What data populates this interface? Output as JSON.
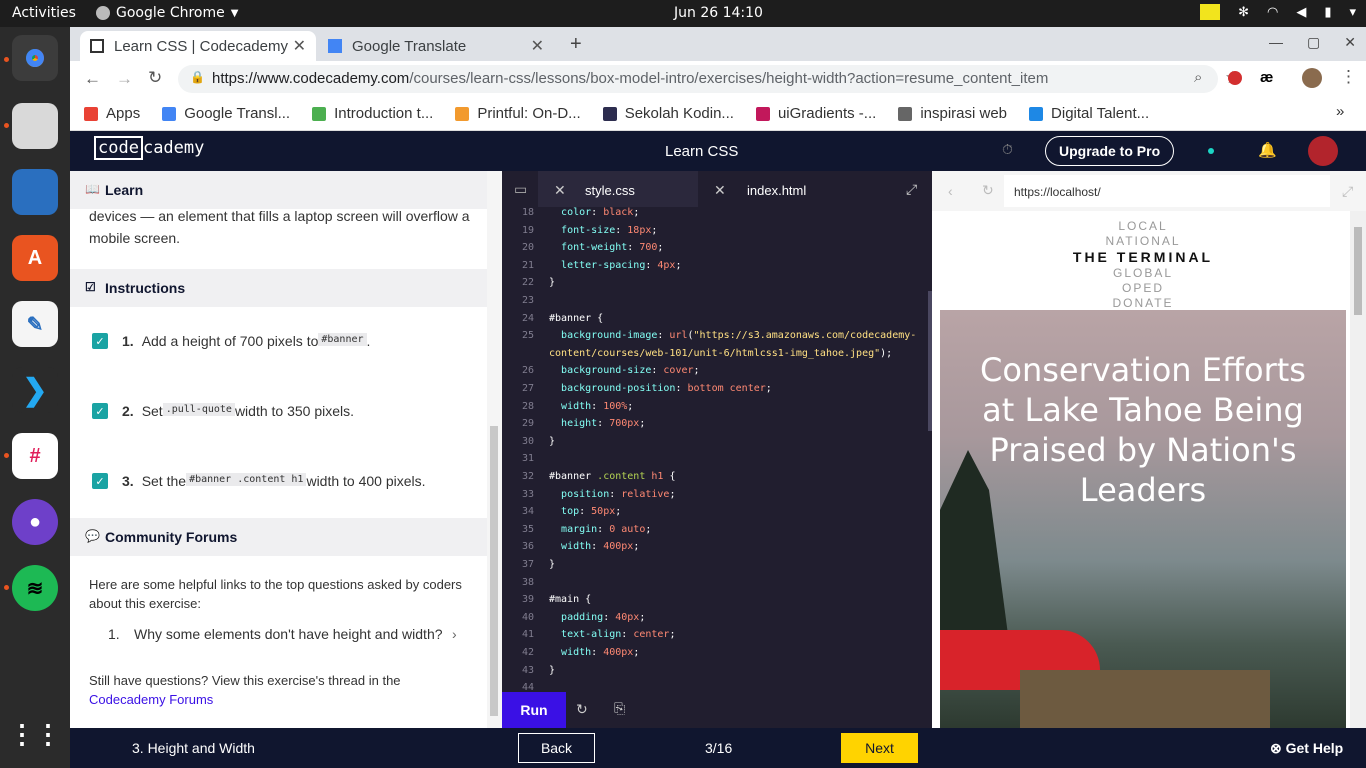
{
  "system": {
    "activities": "Activities",
    "app_menu": "Google Chrome",
    "clock": "Jun 26  14:10"
  },
  "tabs": [
    {
      "label": "Learn CSS | Codecademy",
      "active": true
    },
    {
      "label": "Google Translate",
      "active": false
    }
  ],
  "address": {
    "url_host": "https://www.codecademy.com",
    "url_path": "/courses/learn-css/lessons/box-model-intro/exercises/height-width?action=resume_content_item"
  },
  "bookmarks": [
    "Apps",
    "Google Transl...",
    "Introduction t...",
    "Printful: On-D...",
    "Sekolah Kodin...",
    "uiGradients -...",
    "inspirasi web",
    "Digital Talent..."
  ],
  "app": {
    "logo_a": "code",
    "logo_b": "cademy",
    "title": "Learn CSS",
    "upgrade": "Upgrade to Pro"
  },
  "learn": {
    "header": "Learn",
    "text": "devices — an element that fills a laptop screen will overflow a mobile screen.",
    "instructions_header": "Instructions",
    "instructions": [
      {
        "num": "1.",
        "pre": "Add a height of 700 pixels to ",
        "code": "#banner",
        "post": "."
      },
      {
        "num": "2.",
        "pre": "Set ",
        "code": ".pull-quote",
        "post": " width to 350 pixels."
      },
      {
        "num": "3.",
        "pre": "Set the ",
        "code": "#banner .content h1",
        "post": " width to 400 pixels."
      }
    ],
    "forums_header": "Community Forums",
    "forums_intro": "Here are some helpful links to the top questions asked by coders about this exercise:",
    "forum_item_num": "1.",
    "forum_item": "Why some elements don't have height and width?",
    "still": "Still have questions? View this exercise's thread in the",
    "forums_link": "Codecademy Forums"
  },
  "editor": {
    "tab1": "style.css",
    "tab2": "index.html",
    "run": "Run",
    "lines": [
      {
        "n": "18",
        "t": "  color: black;"
      },
      {
        "n": "19",
        "t": "  font-size: 18px;"
      },
      {
        "n": "20",
        "t": "  font-weight: 700;"
      },
      {
        "n": "21",
        "t": "  letter-spacing: 4px;"
      },
      {
        "n": "22",
        "t": "}"
      },
      {
        "n": "23",
        "t": ""
      },
      {
        "n": "24",
        "t": "#banner {"
      },
      {
        "n": "25",
        "t": "  background-image: url(\"https://s3.amazonaws.com/codecademy-"
      },
      {
        "n": "",
        "t": "content/courses/web-101/unit-6/htmlcss1-img_tahoe.jpeg\");"
      },
      {
        "n": "26",
        "t": "  background-size: cover;"
      },
      {
        "n": "27",
        "t": "  background-position: bottom center;"
      },
      {
        "n": "28",
        "t": "  width: 100%;"
      },
      {
        "n": "29",
        "t": "  height: 700px;"
      },
      {
        "n": "30",
        "t": "}"
      },
      {
        "n": "31",
        "t": ""
      },
      {
        "n": "32",
        "t": "#banner .content h1 {"
      },
      {
        "n": "33",
        "t": "  position: relative;"
      },
      {
        "n": "34",
        "t": "  top: 50px;"
      },
      {
        "n": "35",
        "t": "  margin: 0 auto;"
      },
      {
        "n": "36",
        "t": "  width: 400px;"
      },
      {
        "n": "37",
        "t": "}"
      },
      {
        "n": "38",
        "t": ""
      },
      {
        "n": "39",
        "t": "#main {"
      },
      {
        "n": "40",
        "t": "  padding: 40px;"
      },
      {
        "n": "41",
        "t": "  text-align: center;"
      },
      {
        "n": "42",
        "t": "  width: 400px;"
      },
      {
        "n": "43",
        "t": "}"
      },
      {
        "n": "44",
        "t": ""
      }
    ]
  },
  "preview": {
    "url": "https://localhost/",
    "nav": [
      "LOCAL",
      "NATIONAL",
      "THE TERMINAL",
      "GLOBAL",
      "OPED",
      "DONATE"
    ],
    "headline": "Conservation Efforts at Lake Tahoe Being Praised by Nation's Leaders"
  },
  "footer": {
    "exercise": "3. Height and Width",
    "back": "Back",
    "progress": "3/16",
    "next": "Next",
    "help": "Get Help"
  }
}
